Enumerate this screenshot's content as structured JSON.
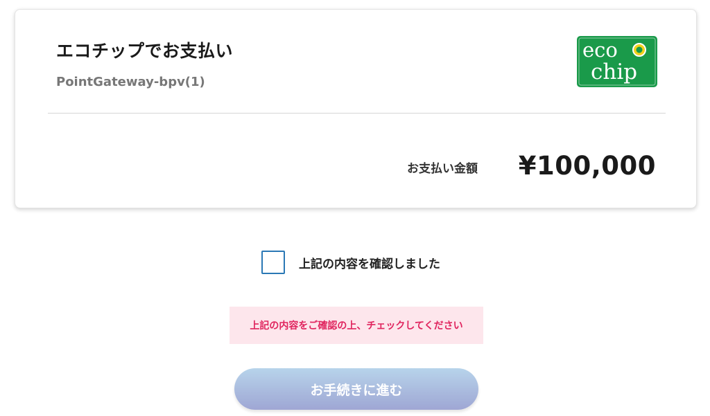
{
  "payment": {
    "title": "エコチップでお支払い",
    "merchant": "PointGateway-bpv(1)",
    "amount_label": "お支払い金額",
    "amount": "¥100,000"
  },
  "logo": {
    "line1": "eco",
    "line2": "chip",
    "color": "#1a9a4a"
  },
  "confirm": {
    "checked": false,
    "label": "上記の内容を確認しました"
  },
  "error": {
    "message": "上記の内容をご確認の上、チェックしてください",
    "color": "#e0245e",
    "background": "#fde6ec"
  },
  "actions": {
    "proceed_label": "お手続きに進む",
    "enabled": false
  }
}
